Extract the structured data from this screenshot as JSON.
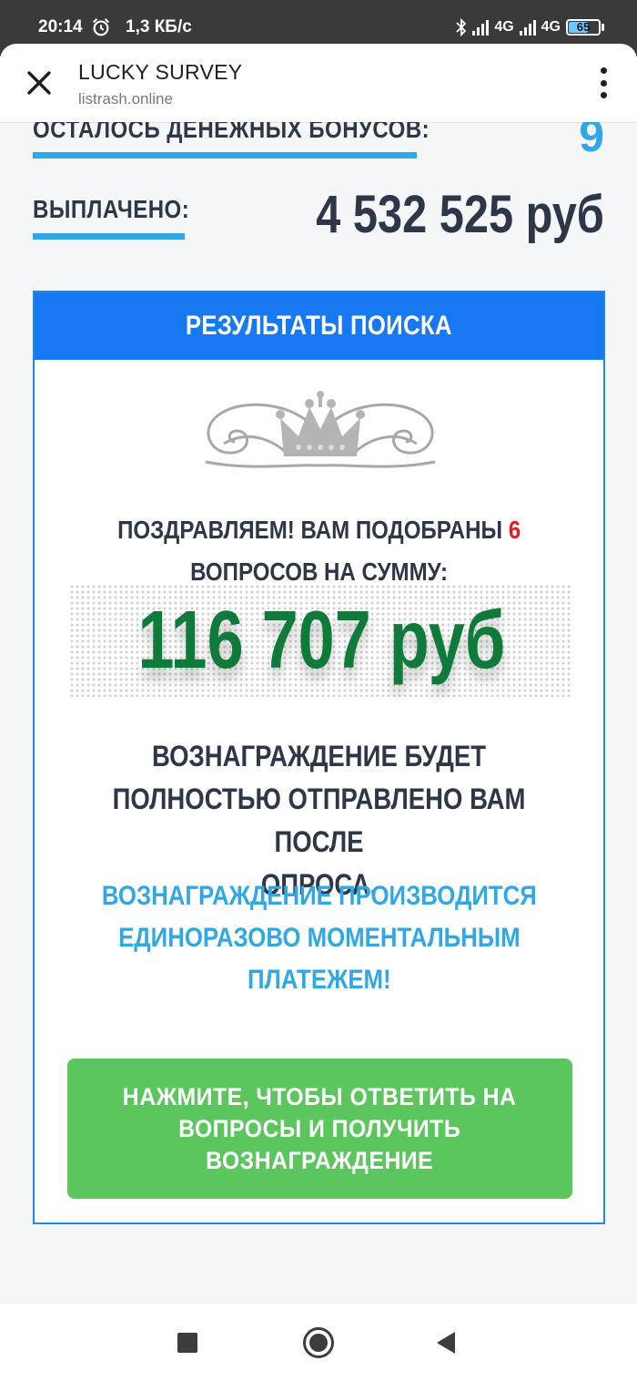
{
  "status_bar": {
    "time": "20:14",
    "speed": "1,3 КБ/с",
    "net1": "4G",
    "net2": "4G",
    "battery": "65"
  },
  "browser": {
    "title": "LUCKY SURVEY",
    "url": "listrash.online"
  },
  "stats": {
    "bonuses_label": "ОСТАЛОСЬ ДЕНЕЖНЫХ БОНУСОВ:",
    "bonuses_value": "9",
    "paid_label": "ВЫПЛАЧЕНО:",
    "paid_value": "4 532 525 руб"
  },
  "panel": {
    "header": "РЕЗУЛЬТАТЫ ПОИСКА",
    "congrats_prefix": "ПОЗДРАВЛЯЕМ! ВАМ ПОДОБРАНЫ",
    "questions_count": "6",
    "congrats_suffix": "ВОПРОСОВ НА СУММУ:",
    "amount": "116 707 руб",
    "reward_line1": "ВОЗНАГРАЖДЕНИЕ БУДЕТ",
    "reward_line2": "ПОЛНОСТЬЮ ОТПРАВЛЕНО ВАМ ПОСЛЕ",
    "reward_line3": "ОПРОСА.",
    "instant_line1": "ВОЗНАГРАЖДЕНИЕ ПРОИЗВОДИТСЯ",
    "instant_line2": "ЕДИНОРАЗОВО МОМЕНТАЛЬНЫМ",
    "instant_line3": "ПЛАТЕЖЕМ!",
    "cta_line1": "НАЖМИТЕ, ЧТОБЫ ОТВЕТИТЬ НА",
    "cta_line2": "ВОПРОСЫ И ПОЛУЧИТЬ",
    "cta_line3": "ВОЗНАГРАЖДЕНИЕ"
  },
  "colors": {
    "accent_blue": "#1679f2",
    "light_blue": "#2ea8e6",
    "green_amount": "#0f7a3a",
    "cta_green": "#5cc65e",
    "red": "#e02020"
  }
}
